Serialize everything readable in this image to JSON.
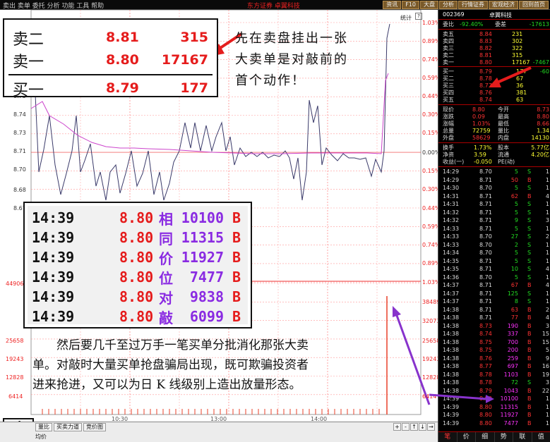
{
  "topbar": {
    "left_text": "卖出 卖单 委托 分析 功能 工具 帮助",
    "red_text": "东方证券 卓翼科技",
    "tabs": [
      "资讯",
      "F10",
      "大盘",
      "分析",
      "行情证券",
      "宏观经济",
      "回到首页"
    ]
  },
  "chart": {
    "tag": "统计",
    "tag_button": "?",
    "price_left": [
      "8.75",
      "8.74",
      "8.73",
      "8.72",
      "8.71",
      "8.70",
      "8.69",
      "8.68",
      "8.67"
    ],
    "pct_right": [
      "1.03%",
      "0.89%",
      "0.74%",
      "0.59%",
      "0.44%",
      "0.30%",
      "0.15%",
      "0.00%",
      "0.15%",
      "0.30%",
      "0.44%",
      "0.59%",
      "0.74%",
      "0.89%",
      "1.03%"
    ],
    "vol_left": [
      "44906",
      "38489",
      "32073",
      "25658",
      "19243",
      "12828",
      "6414"
    ],
    "vol_right": [
      "44906",
      "38489",
      "32073",
      "25658",
      "19243",
      "12828",
      "6414"
    ],
    "x_labels": [
      "10:30",
      "13:00",
      "14:00"
    ],
    "colors": {
      "price_line": "#3a3a6a",
      "avg_line": "#cc44cc",
      "grid": "#ff9999",
      "volume": "#e8402a"
    }
  },
  "order_book_zoom": {
    "rows": [
      {
        "label": "卖二",
        "price": "8.81",
        "volume": "315"
      },
      {
        "label": "卖一",
        "price": "8.80",
        "volume": "17167"
      },
      {
        "label": "买一",
        "price": "8.79",
        "volume": "177"
      }
    ]
  },
  "note1": "先在卖盘挂出一张大卖单是对敲前的首个动作！",
  "tick_zoom": {
    "rows": [
      {
        "time": "14:39",
        "price": "8.80",
        "char": "相",
        "volume": "10100",
        "side": "B"
      },
      {
        "time": "14:39",
        "price": "8.80",
        "char": "同",
        "volume": "11315",
        "side": "B"
      },
      {
        "time": "14:39",
        "price": "8.80",
        "char": "价",
        "volume": "11927",
        "side": "B"
      },
      {
        "time": "14:39",
        "price": "8.80",
        "char": "位",
        "volume": "7477",
        "side": "B"
      },
      {
        "time": "14:39",
        "price": "8.80",
        "char": "对",
        "volume": "9838",
        "side": "B"
      },
      {
        "time": "14:39",
        "price": "8.80",
        "char": "敲",
        "volume": "6099",
        "side": "B"
      }
    ]
  },
  "note2": "然后要几千至过万手一笔买单分批消化那张大卖单。对敲时大量买单抢盘骗局出现，既可欺骗投资者进来抢进，又可以为日 K 线级别上造出放量形态。",
  "page_number": "4",
  "bottombar": {
    "tabs": [
      "量比",
      "买卖力道",
      "竞价图"
    ],
    "sub": "均价",
    "controls": [
      "+",
      "-",
      "↑",
      "↓",
      "→"
    ]
  },
  "panel": {
    "code": "002369",
    "name": "卓翼科技",
    "weibi": {
      "label": "委比",
      "value": "-92.40%",
      "label2": "委差",
      "value2": "-17613"
    },
    "asks": [
      {
        "label": "卖五",
        "price": "8.84",
        "vol": "231"
      },
      {
        "label": "卖四",
        "price": "8.83",
        "vol": "302"
      },
      {
        "label": "卖三",
        "price": "8.82",
        "vol": "322"
      },
      {
        "label": "卖二",
        "price": "8.81",
        "vol": "315"
      },
      {
        "label": "卖一",
        "price": "8.80",
        "vol": "17167",
        "extra": "-7467"
      }
    ],
    "bids": [
      {
        "label": "买一",
        "price": "8.79",
        "vol": "177",
        "extra": "-60"
      },
      {
        "label": "买二",
        "price": "8.78",
        "vol": "67"
      },
      {
        "label": "买三",
        "price": "8.77",
        "vol": "36"
      },
      {
        "label": "买四",
        "price": "8.76",
        "vol": "381"
      },
      {
        "label": "买五",
        "price": "8.74",
        "vol": "63"
      }
    ],
    "stats": [
      {
        "l1": "现价",
        "v1": "8.80",
        "l2": "今开",
        "v2": "8.73"
      },
      {
        "l1": "涨跌",
        "v1": "0.09",
        "l2": "最高",
        "v2": "8.80"
      },
      {
        "l1": "涨幅",
        "v1": "1.03%",
        "l2": "最低",
        "v2": "8.66"
      },
      {
        "l1": "总量",
        "v1": "72759",
        "l2": "量比",
        "v2": "1.34"
      },
      {
        "l1": "外盘",
        "v1": "58629",
        "l2": "内盘",
        "v2": "14130"
      }
    ],
    "stats2": [
      {
        "l1": "换手",
        "v1": "1.73%",
        "l2": "股本",
        "v2": "5.77亿"
      },
      {
        "l1": "净资",
        "v1": "3.59",
        "l2": "流通",
        "v2": "4.20亿"
      },
      {
        "l1": "收益(一)",
        "v1": "-0.050",
        "l2": "PE(动)",
        "v2": ""
      }
    ],
    "ticks": [
      {
        "t": "14:29",
        "p": "8.70",
        "v": "5",
        "s": "S",
        "n": "1"
      },
      {
        "t": "14:29",
        "p": "8.71",
        "v": "50",
        "s": "B",
        "n": "1"
      },
      {
        "t": "14:30",
        "p": "8.70",
        "v": "5",
        "s": "S",
        "n": "1"
      },
      {
        "t": "14:31",
        "p": "8.71",
        "v": "62",
        "s": "B",
        "n": "4"
      },
      {
        "t": "14:31",
        "p": "8.71",
        "v": "5",
        "s": "S",
        "n": "1"
      },
      {
        "t": "14:32",
        "p": "8.71",
        "v": "5",
        "s": "S",
        "n": "1"
      },
      {
        "t": "14:32",
        "p": "8.71",
        "v": "9",
        "s": "S",
        "n": "3"
      },
      {
        "t": "14:33",
        "p": "8.71",
        "v": "5",
        "s": "S",
        "n": "1"
      },
      {
        "t": "14:33",
        "p": "8.70",
        "v": "27",
        "s": "S",
        "n": "2"
      },
      {
        "t": "14:33",
        "p": "8.70",
        "v": "2",
        "s": "S",
        "n": "1"
      },
      {
        "t": "14:34",
        "p": "8.70",
        "v": "5",
        "s": "S",
        "n": "1"
      },
      {
        "t": "14:35",
        "p": "8.71",
        "v": "5",
        "s": "S",
        "n": "1"
      },
      {
        "t": "14:35",
        "p": "8.71",
        "v": "10",
        "s": "S",
        "n": "4"
      },
      {
        "t": "14:36",
        "p": "8.70",
        "v": "5",
        "s": "S",
        "n": "1"
      },
      {
        "t": "14:37",
        "p": "8.71",
        "v": "67",
        "s": "B",
        "n": "4"
      },
      {
        "t": "14:37",
        "p": "8.71",
        "v": "125",
        "s": "S",
        "n": "1"
      },
      {
        "t": "14:37",
        "p": "8.71",
        "v": "8",
        "s": "S",
        "n": "1"
      },
      {
        "t": "14:38",
        "p": "8.71",
        "v": "63",
        "s": "B",
        "n": "2"
      },
      {
        "t": "14:38",
        "p": "8.71",
        "v": "77",
        "s": "B",
        "n": "4"
      },
      {
        "t": "14:38",
        "p": "8.73",
        "v": "190",
        "s": "B",
        "n": "3"
      },
      {
        "t": "14:38",
        "p": "8.74",
        "v": "337",
        "s": "B",
        "n": "15"
      },
      {
        "t": "14:38",
        "p": "8.75",
        "v": "700",
        "s": "B",
        "n": "15"
      },
      {
        "t": "14:38",
        "p": "8.75",
        "v": "200",
        "s": "B",
        "n": "5"
      },
      {
        "t": "14:38",
        "p": "8.76",
        "v": "259",
        "s": "B",
        "n": "9"
      },
      {
        "t": "14:38",
        "p": "8.77",
        "v": "697",
        "s": "B",
        "n": "16"
      },
      {
        "t": "14:38",
        "p": "8.78",
        "v": "1103",
        "s": "B",
        "n": "19"
      },
      {
        "t": "14:38",
        "p": "8.78",
        "v": "72",
        "s": "S",
        "n": "3"
      },
      {
        "t": "14:38",
        "p": "8.79",
        "v": "1043",
        "s": "B",
        "n": "22"
      },
      {
        "t": "14:39",
        "p": "8.80",
        "v": "10100",
        "s": "B",
        "n": "1"
      },
      {
        "t": "14:39",
        "p": "8.80",
        "v": "11315",
        "s": "B",
        "n": "1"
      },
      {
        "t": "14:39",
        "p": "8.80",
        "v": "11927",
        "s": "B",
        "n": "1"
      },
      {
        "t": "14:39",
        "p": "8.80",
        "v": "7477",
        "s": "B",
        "n": "1"
      }
    ],
    "footer_tabs": [
      "笔",
      "价",
      "细",
      "势",
      "联",
      "值"
    ]
  }
}
